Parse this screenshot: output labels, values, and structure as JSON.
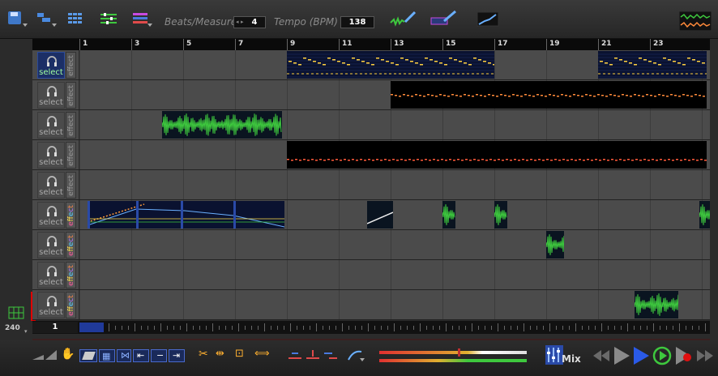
{
  "toolbar": {
    "beats_label": "Beats/Measure",
    "beats_value": "4",
    "tempo_label": "Tempo (BPM)",
    "tempo_value": "138"
  },
  "ruler": {
    "labels": [
      "1",
      "3",
      "5",
      "7",
      "9",
      "11",
      "13",
      "15",
      "17",
      "19",
      "21",
      "23"
    ]
  },
  "tracks": [
    {
      "select": "select",
      "effect": "effect",
      "active": true,
      "effect_colored": false
    },
    {
      "select": "select",
      "effect": "effect",
      "active": false,
      "effect_colored": false
    },
    {
      "select": "select",
      "effect": "effect",
      "active": false,
      "effect_colored": false
    },
    {
      "select": "select",
      "effect": "effect",
      "active": false,
      "effect_colored": false
    },
    {
      "select": "select",
      "effect": "effect",
      "active": false,
      "effect_colored": false
    },
    {
      "select": "select",
      "effect": "effect",
      "active": false,
      "effect_colored": true
    },
    {
      "select": "select",
      "effect": "effect",
      "active": false,
      "effect_colored": true
    },
    {
      "select": "select",
      "effect": "effect",
      "active": false,
      "effect_colored": true
    },
    {
      "select": "select",
      "effect": "effect",
      "active": false,
      "effect_colored": true
    }
  ],
  "position": {
    "value": "1"
  },
  "zoom": {
    "value": "240"
  },
  "mix": {
    "label": "Mix"
  },
  "colors": {
    "accent": "#2a4aa8",
    "wave": "#3ec83e",
    "midi_note": "#ffd040"
  }
}
